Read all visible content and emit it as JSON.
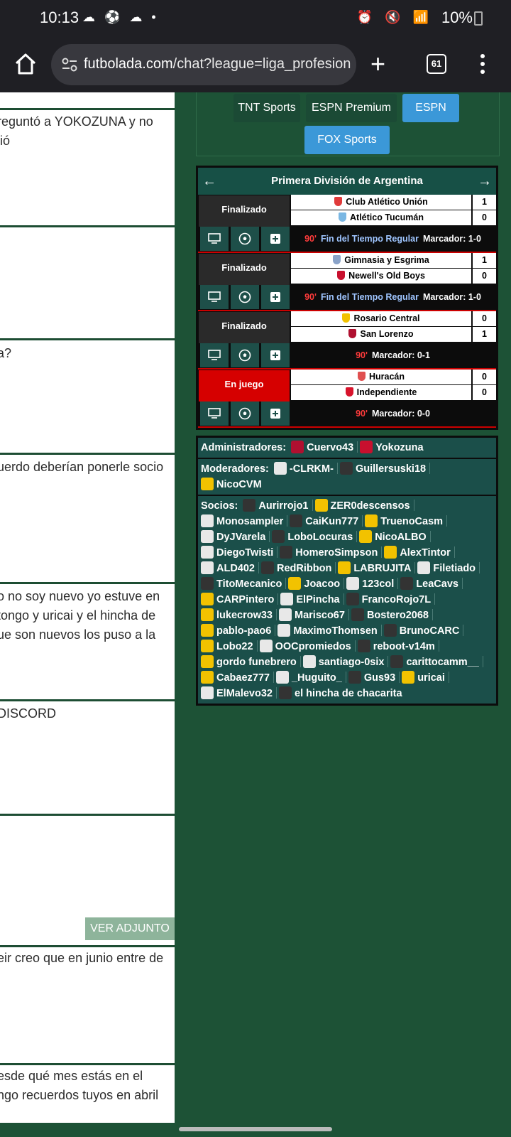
{
  "status_bar": {
    "time": "10:13",
    "battery": "10%"
  },
  "browser": {
    "url_domain": "futbolada.com",
    "url_path": "/chat?league=liga_profesiona",
    "tab_count": "61"
  },
  "chat": {
    "messages": [
      "reguntó a YOKOZUNA y no",
      "lió",
      "a?",
      "uerdo deberían ponerle socio",
      "o no soy nuevo yo estuve en",
      "tongo y uricai y el hincha de",
      "ue son nuevos los puso a la",
      "DISCORD",
      "eir creo que en junio entre de",
      "esde qué mes estás en el",
      "ngo recuerdos tuyos en abril"
    ],
    "attachment_label": "VER ADJUNTO"
  },
  "channels": [
    "TNT Sports",
    "ESPN Premium",
    "ESPN",
    "FOX Sports"
  ],
  "league": {
    "title": "Primera División de Argentina",
    "prev": "←",
    "next": "→",
    "matches": [
      {
        "status": "Finalizado",
        "home": "Club Atlético Unión",
        "home_score": "1",
        "away": "Atlético Tucumán",
        "away_score": "0",
        "minute": "90'",
        "regular": "Fin del Tiempo Regular",
        "score": "Marcador: 1-0",
        "home_color": "#e03a3a",
        "away_color": "#7ab7e3"
      },
      {
        "status": "Finalizado",
        "home": "Gimnasia y Esgrima",
        "home_score": "1",
        "away": "Newell's Old Boys",
        "away_score": "0",
        "minute": "90'",
        "regular": "Fin del Tiempo Regular",
        "score": "Marcador: 1-0",
        "home_color": "#8aa3c9",
        "away_color": "#c8102e"
      },
      {
        "status": "Finalizado",
        "home": "Rosario Central",
        "home_score": "0",
        "away": "San Lorenzo",
        "away_score": "1",
        "minute": "90'",
        "regular": "",
        "score": "Marcador: 0-1",
        "home_color": "#f2c200",
        "away_color": "#b01030"
      },
      {
        "status": "En juego",
        "home": "Huracán",
        "home_score": "0",
        "away": "Independiente",
        "away_score": "0",
        "minute": "90'",
        "regular": "",
        "score": "Marcador: 0-0",
        "home_color": "#e05050",
        "away_color": "#d8132b"
      }
    ]
  },
  "users": {
    "admins_label": "Administradores:",
    "admins": [
      "Cuervo43",
      "Yokozuna"
    ],
    "mods_label": "Moderadores:",
    "mods": [
      "-CLRKM-",
      "Guillersuski18",
      "NicoCVM"
    ],
    "members_label": "Socios:",
    "members": [
      "Aurirrojo1",
      "ZER0descensos",
      "Monosampler",
      "CaiKun777",
      "TruenoCasm",
      "DyJVarela",
      "LoboLocuras",
      "NicoALBO",
      "DiegoTwisti",
      "HomeroSimpson",
      "AlexTintor",
      "ALD402",
      "RedRibbon",
      "LABRUJITA",
      "Filetiado",
      "TitoMecanico",
      "Joacoo",
      "123col",
      "LeaCavs",
      "CARPintero",
      "ElPincha",
      "FrancoRojo7L",
      "lukecrow33",
      "Marisco67",
      "Bostero2068",
      "pablo-pao6",
      "MaximoThomsen",
      "BrunoCARC",
      "Lobo22",
      "OOCpromiedos",
      "reboot-v14m",
      "gordo funebrero",
      "santiago-0six",
      "carittocamm__",
      "Cabaez777",
      "_Huguito_",
      "Gus93",
      "uricai",
      "ElMalevo32",
      "el hincha de chacarita"
    ]
  }
}
